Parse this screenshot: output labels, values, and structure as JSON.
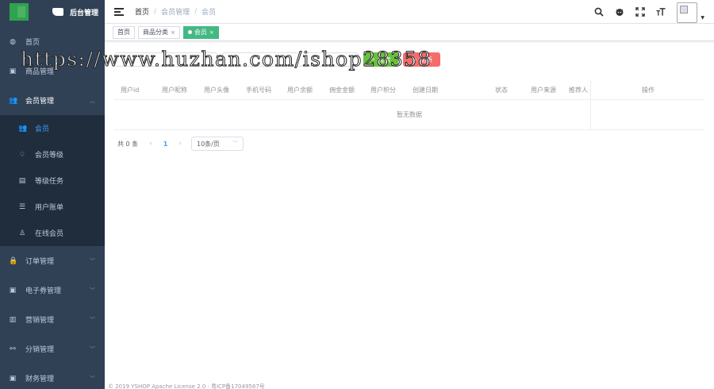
{
  "app": {
    "logo_title": "后台管理"
  },
  "sidebar": {
    "items": [
      {
        "label": "首页",
        "icon": "dashboard-icon"
      },
      {
        "label": "商品管理",
        "icon": "shop-icon"
      },
      {
        "label": "会员管理",
        "icon": "user-group-icon",
        "expanded": true
      },
      {
        "label": "订单管理",
        "icon": "lock-icon"
      },
      {
        "label": "电子券管理",
        "icon": "coupon-icon"
      },
      {
        "label": "营销管理",
        "icon": "chart-icon"
      },
      {
        "label": "分销管理",
        "icon": "share-icon"
      },
      {
        "label": "财务管理",
        "icon": "finance-icon"
      }
    ],
    "member_sub": [
      {
        "label": "会员",
        "icon": "peoples-icon",
        "active": true
      },
      {
        "label": "会员等级",
        "icon": "diamond-icon"
      },
      {
        "label": "等级任务",
        "icon": "task-icon"
      },
      {
        "label": "用户账单",
        "icon": "list-icon"
      },
      {
        "label": "在线会员",
        "icon": "online-user-icon"
      }
    ]
  },
  "navbar": {
    "breadcrumb": [
      "首页",
      "会员管理",
      "会员"
    ],
    "tools": [
      "search-icon",
      "github-icon",
      "fullscreen-icon",
      "text-size-icon"
    ]
  },
  "tags": [
    {
      "label": "首页",
      "active": false
    },
    {
      "label": "商品分类",
      "active": false
    },
    {
      "label": "会员",
      "active": true
    }
  ],
  "toolbar": {
    "search_label": "搜索",
    "refresh_label": "刷新"
  },
  "table": {
    "columns": [
      "用户id",
      "用户昵称",
      "用户头像",
      "手机号码",
      "用户余额",
      "佣金金额",
      "用户积分",
      "创建日期",
      "状态",
      "用户来源",
      "推荐人",
      "操作"
    ],
    "empty_text": "暂无数据"
  },
  "pagination": {
    "total_text": "共 0 条",
    "current_page": "1",
    "page_size": "10条/页"
  },
  "watermark": "https://www.huzhan.com/ishop28358",
  "footer": "© 2019 YSHOP Apache License 2.0 · 粤ICP备17049587号",
  "colors": {
    "sidebar_bg": "#304156",
    "submenu_bg": "#1f2d3d",
    "active_text": "#409eff",
    "tag_active": "#42b983",
    "search_button": "#67c23a",
    "refresh_button": "#f56c6c"
  }
}
